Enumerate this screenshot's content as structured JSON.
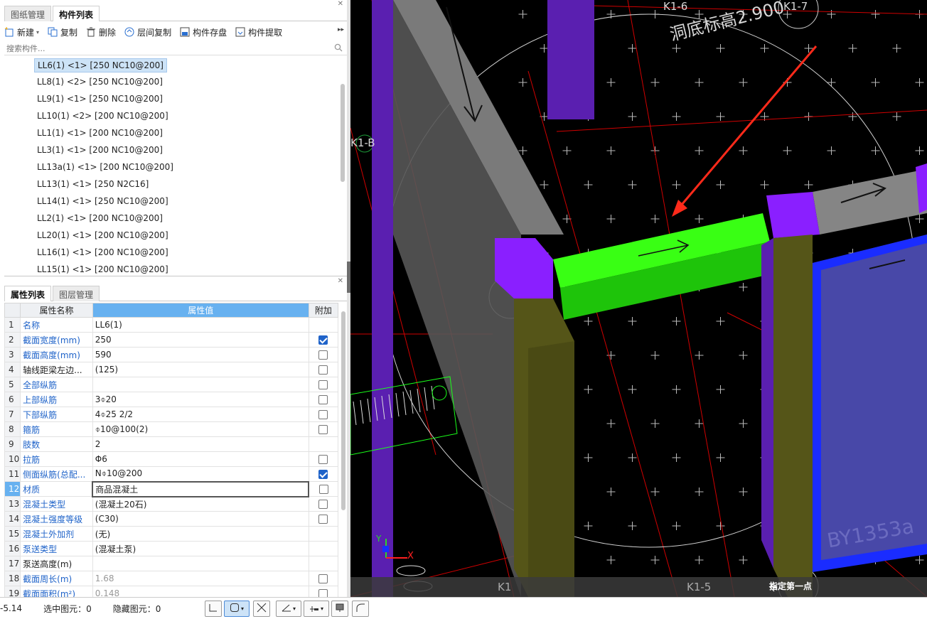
{
  "top_tabs": [
    {
      "label": "图纸管理",
      "active": false
    },
    {
      "label": "构件列表",
      "active": true
    }
  ],
  "toolbar": {
    "new_label": "新建",
    "copy_label": "复制",
    "delete_label": "删除",
    "floor_copy_label": "层间复制",
    "save_label": "构件存盘",
    "extract_label": "构件提取"
  },
  "search": {
    "placeholder": "搜索构件..."
  },
  "components": [
    "LL6(1) <1> [250 NC10@200]",
    "LL8(1) <2> [250 NC10@200]",
    "LL9(1) <1> [250 NC10@200]",
    "LL10(1) <2> [200 NC10@200]",
    "LL1(1) <1> [200 NC10@200]",
    "LL3(1) <1> [200 NC10@200]",
    "LL13a(1) <1> [200 NC10@200]",
    "LL13(1) <1> [250 N2C16]",
    "LL14(1) <1> [250 NC10@200]",
    "LL2(1) <1> [200 NC10@200]",
    "LL20(1) <1> [200 NC10@200]",
    "LL16(1) <1> [200 NC10@200]",
    "LL15(1) <1> [200 NC10@200]"
  ],
  "bottom_tabs": [
    {
      "label": "属性列表",
      "active": true
    },
    {
      "label": "图层管理",
      "active": false
    }
  ],
  "props_header": {
    "name": "属性名称",
    "value": "属性值",
    "extra": "附加"
  },
  "properties": [
    {
      "no": "1",
      "name": "名称",
      "value": "LL6(1)",
      "blue": true,
      "check": null
    },
    {
      "no": "2",
      "name": "截面宽度(mm)",
      "value": "250",
      "blue": true,
      "check": true
    },
    {
      "no": "3",
      "name": "截面高度(mm)",
      "value": "590",
      "blue": true,
      "check": false
    },
    {
      "no": "4",
      "name": "轴线距梁左边...",
      "value": "(125)",
      "blue": false,
      "check": false
    },
    {
      "no": "5",
      "name": "全部纵筋",
      "value": "",
      "blue": true,
      "check": false
    },
    {
      "no": "6",
      "name": "上部纵筋",
      "value": "3⌽20",
      "blue": true,
      "check": false
    },
    {
      "no": "7",
      "name": "下部纵筋",
      "value": "4⌽25 2/2",
      "blue": true,
      "check": false
    },
    {
      "no": "8",
      "name": "箍筋",
      "value": "⌽10@100(2)",
      "blue": true,
      "check": false
    },
    {
      "no": "9",
      "name": "肢数",
      "value": "2",
      "blue": true,
      "check": null
    },
    {
      "no": "10",
      "name": "拉筋",
      "value": "Φ6",
      "blue": true,
      "check": false
    },
    {
      "no": "11",
      "name": "侧面纵筋(总配...",
      "value": "N⌽10@200",
      "blue": true,
      "check": true
    },
    {
      "no": "12",
      "name": "材质",
      "value": "商品混凝土",
      "blue": true,
      "check": false,
      "current": true
    },
    {
      "no": "13",
      "name": "混凝土类型",
      "value": "(混凝土20石)",
      "blue": true,
      "check": false
    },
    {
      "no": "14",
      "name": "混凝土强度等级",
      "value": "(C30)",
      "blue": true,
      "check": false
    },
    {
      "no": "15",
      "name": "混凝土外加剂",
      "value": "(无)",
      "blue": true,
      "check": null
    },
    {
      "no": "16",
      "name": "泵送类型",
      "value": "(混凝土泵)",
      "blue": true,
      "check": null
    },
    {
      "no": "17",
      "name": "泵送高度(m)",
      "value": "",
      "blue": false,
      "check": null
    },
    {
      "no": "18",
      "name": "截面周长(m)",
      "value": "1.68",
      "blue": true,
      "check": false,
      "gray": true
    },
    {
      "no": "19",
      "name": "截面面积(m²)",
      "value": "0.148",
      "blue": true,
      "check": false,
      "gray": true
    }
  ],
  "status": {
    "coord": "-5.14",
    "selected_label": "选中图元：0",
    "hidden_label": "隐藏图元：0"
  },
  "viewport": {
    "labels": [
      "K1-6",
      "K1-7",
      "K1-B",
      "K1",
      "K1-5"
    ],
    "elevation_text": "洞底标高2.900",
    "plate_text": "BY1353a",
    "prompt": "指定第一点",
    "axis_x": "X",
    "axis_y": "Y"
  }
}
